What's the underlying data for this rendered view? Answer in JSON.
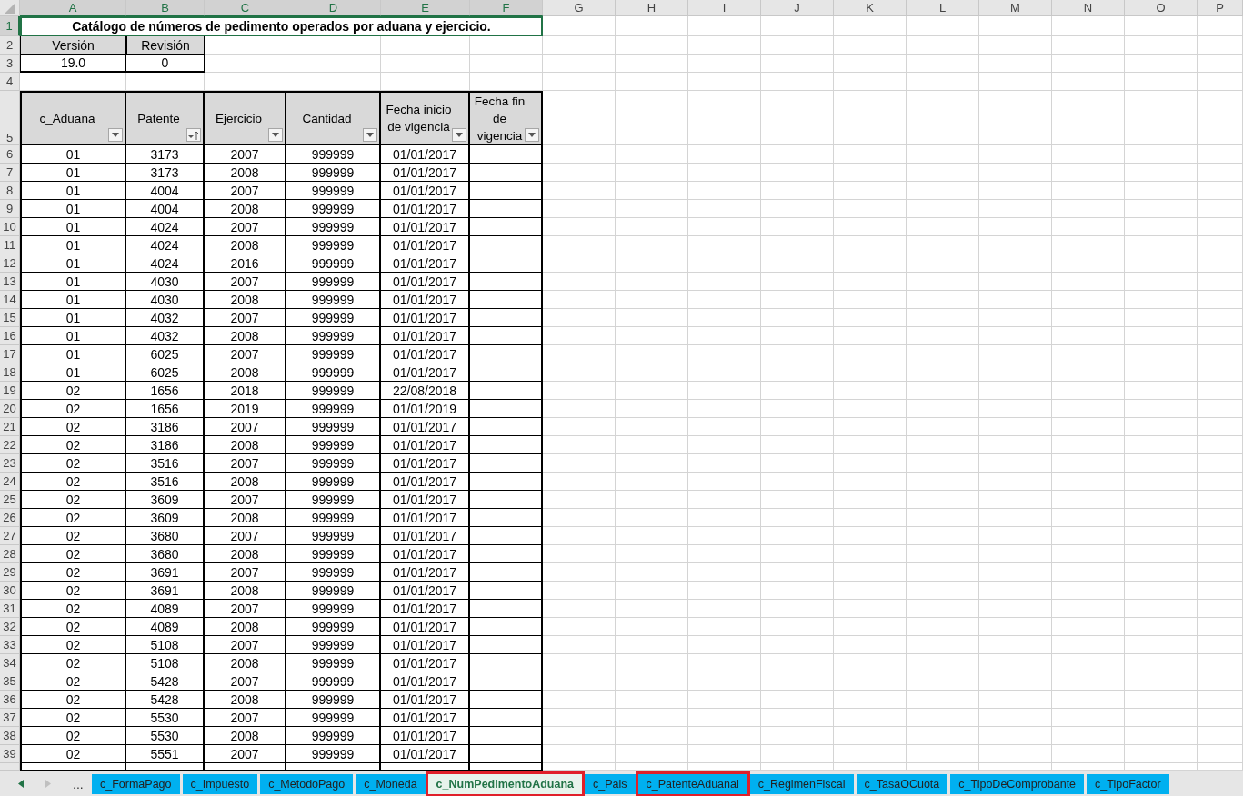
{
  "columns": [
    {
      "label": "A",
      "selected": true
    },
    {
      "label": "B",
      "selected": true
    },
    {
      "label": "C",
      "selected": true
    },
    {
      "label": "D",
      "selected": true
    },
    {
      "label": "E",
      "selected": true
    },
    {
      "label": "F",
      "selected": true
    },
    {
      "label": "G",
      "selected": false
    },
    {
      "label": "H",
      "selected": false
    },
    {
      "label": "I",
      "selected": false
    },
    {
      "label": "J",
      "selected": false
    },
    {
      "label": "K",
      "selected": false
    },
    {
      "label": "L",
      "selected": false
    },
    {
      "label": "M",
      "selected": false
    },
    {
      "label": "N",
      "selected": false
    },
    {
      "label": "O",
      "selected": false
    },
    {
      "label": "P",
      "selected": false
    }
  ],
  "rows": [
    {
      "kind": "title",
      "row": "1",
      "selected": true,
      "text": "Catálogo de números de pedimento operados por aduana y ejercicio."
    },
    {
      "kind": "info_header",
      "row": "2",
      "selected": false,
      "cells": [
        "Versión",
        "Revisión"
      ]
    },
    {
      "kind": "info_value",
      "row": "3",
      "selected": false,
      "cells": [
        "19.0",
        "0"
      ]
    },
    {
      "kind": "blank",
      "row": "4",
      "selected": false
    },
    {
      "kind": "table_header",
      "row": "5",
      "selected": false,
      "headers": [
        {
          "label": "c_Aduana",
          "kind": "filter"
        },
        {
          "label": "Patente",
          "kind": "sorted"
        },
        {
          "label": "Ejercicio",
          "kind": "filter"
        },
        {
          "label": "Cantidad",
          "kind": "filter"
        },
        {
          "label": "Fecha inicio de vigencia",
          "kind": "filter"
        },
        {
          "label": "Fecha fin de vigencia",
          "kind": "filter"
        }
      ]
    },
    {
      "kind": "data",
      "row": "6",
      "selected": false,
      "cells": [
        "01",
        "3173",
        "2007",
        "999999",
        "01/01/2017"
      ]
    },
    {
      "kind": "data",
      "row": "7",
      "selected": false,
      "cells": [
        "01",
        "3173",
        "2008",
        "999999",
        "01/01/2017"
      ]
    },
    {
      "kind": "data",
      "row": "8",
      "selected": false,
      "cells": [
        "01",
        "4004",
        "2007",
        "999999",
        "01/01/2017"
      ]
    },
    {
      "kind": "data",
      "row": "9",
      "selected": false,
      "cells": [
        "01",
        "4004",
        "2008",
        "999999",
        "01/01/2017"
      ]
    },
    {
      "kind": "data",
      "row": "10",
      "selected": false,
      "cells": [
        "01",
        "4024",
        "2007",
        "999999",
        "01/01/2017"
      ]
    },
    {
      "kind": "data",
      "row": "11",
      "selected": false,
      "cells": [
        "01",
        "4024",
        "2008",
        "999999",
        "01/01/2017"
      ]
    },
    {
      "kind": "data",
      "row": "12",
      "selected": false,
      "cells": [
        "01",
        "4024",
        "2016",
        "999999",
        "01/01/2017"
      ]
    },
    {
      "kind": "data",
      "row": "13",
      "selected": false,
      "cells": [
        "01",
        "4030",
        "2007",
        "999999",
        "01/01/2017"
      ]
    },
    {
      "kind": "data",
      "row": "14",
      "selected": false,
      "cells": [
        "01",
        "4030",
        "2008",
        "999999",
        "01/01/2017"
      ]
    },
    {
      "kind": "data",
      "row": "15",
      "selected": false,
      "cells": [
        "01",
        "4032",
        "2007",
        "999999",
        "01/01/2017"
      ]
    },
    {
      "kind": "data",
      "row": "16",
      "selected": false,
      "cells": [
        "01",
        "4032",
        "2008",
        "999999",
        "01/01/2017"
      ]
    },
    {
      "kind": "data",
      "row": "17",
      "selected": false,
      "cells": [
        "01",
        "6025",
        "2007",
        "999999",
        "01/01/2017"
      ]
    },
    {
      "kind": "data",
      "row": "18",
      "selected": false,
      "cells": [
        "01",
        "6025",
        "2008",
        "999999",
        "01/01/2017"
      ]
    },
    {
      "kind": "data",
      "row": "19",
      "selected": false,
      "cells": [
        "02",
        "1656",
        "2018",
        "999999",
        "22/08/2018"
      ]
    },
    {
      "kind": "data",
      "row": "20",
      "selected": false,
      "cells": [
        "02",
        "1656",
        "2019",
        "999999",
        "01/01/2019"
      ]
    },
    {
      "kind": "data",
      "row": "21",
      "selected": false,
      "cells": [
        "02",
        "3186",
        "2007",
        "999999",
        "01/01/2017"
      ]
    },
    {
      "kind": "data",
      "row": "22",
      "selected": false,
      "cells": [
        "02",
        "3186",
        "2008",
        "999999",
        "01/01/2017"
      ]
    },
    {
      "kind": "data",
      "row": "23",
      "selected": false,
      "cells": [
        "02",
        "3516",
        "2007",
        "999999",
        "01/01/2017"
      ]
    },
    {
      "kind": "data",
      "row": "24",
      "selected": false,
      "cells": [
        "02",
        "3516",
        "2008",
        "999999",
        "01/01/2017"
      ]
    },
    {
      "kind": "data",
      "row": "25",
      "selected": false,
      "cells": [
        "02",
        "3609",
        "2007",
        "999999",
        "01/01/2017"
      ]
    },
    {
      "kind": "data",
      "row": "26",
      "selected": false,
      "cells": [
        "02",
        "3609",
        "2008",
        "999999",
        "01/01/2017"
      ]
    },
    {
      "kind": "data",
      "row": "27",
      "selected": false,
      "cells": [
        "02",
        "3680",
        "2007",
        "999999",
        "01/01/2017"
      ]
    },
    {
      "kind": "data",
      "row": "28",
      "selected": false,
      "cells": [
        "02",
        "3680",
        "2008",
        "999999",
        "01/01/2017"
      ]
    },
    {
      "kind": "data",
      "row": "29",
      "selected": false,
      "cells": [
        "02",
        "3691",
        "2007",
        "999999",
        "01/01/2017"
      ]
    },
    {
      "kind": "data",
      "row": "30",
      "selected": false,
      "cells": [
        "02",
        "3691",
        "2008",
        "999999",
        "01/01/2017"
      ]
    },
    {
      "kind": "data",
      "row": "31",
      "selected": false,
      "cells": [
        "02",
        "4089",
        "2007",
        "999999",
        "01/01/2017"
      ]
    },
    {
      "kind": "data",
      "row": "32",
      "selected": false,
      "cells": [
        "02",
        "4089",
        "2008",
        "999999",
        "01/01/2017"
      ]
    },
    {
      "kind": "data",
      "row": "33",
      "selected": false,
      "cells": [
        "02",
        "5108",
        "2007",
        "999999",
        "01/01/2017"
      ]
    },
    {
      "kind": "data",
      "row": "34",
      "selected": false,
      "cells": [
        "02",
        "5108",
        "2008",
        "999999",
        "01/01/2017"
      ]
    },
    {
      "kind": "data",
      "row": "35",
      "selected": false,
      "cells": [
        "02",
        "5428",
        "2007",
        "999999",
        "01/01/2017"
      ]
    },
    {
      "kind": "data",
      "row": "36",
      "selected": false,
      "cells": [
        "02",
        "5428",
        "2008",
        "999999",
        "01/01/2017"
      ]
    },
    {
      "kind": "data",
      "row": "37",
      "selected": false,
      "cells": [
        "02",
        "5530",
        "2007",
        "999999",
        "01/01/2017"
      ]
    },
    {
      "kind": "data",
      "row": "38",
      "selected": false,
      "cells": [
        "02",
        "5530",
        "2008",
        "999999",
        "01/01/2017"
      ]
    },
    {
      "kind": "data",
      "row": "39",
      "selected": false,
      "cells": [
        "02",
        "5551",
        "2007",
        "999999",
        "01/01/2017"
      ]
    }
  ],
  "sheet_nav": {
    "more": "..."
  },
  "tabs": [
    {
      "label": "c_FormaPago",
      "selected": false,
      "flagged": false
    },
    {
      "label": "c_Impuesto",
      "selected": false,
      "flagged": false
    },
    {
      "label": "c_MetodoPago",
      "selected": false,
      "flagged": false
    },
    {
      "label": "c_Moneda",
      "selected": false,
      "flagged": false
    },
    {
      "label": "c_NumPedimentoAduana",
      "selected": true,
      "flagged": true
    },
    {
      "label": "c_Pais",
      "selected": false,
      "flagged": false
    },
    {
      "label": "c_PatenteAduanal",
      "selected": false,
      "flagged": true
    },
    {
      "label": "c_RegimenFiscal",
      "selected": false,
      "flagged": false
    },
    {
      "label": "c_TasaOCuota",
      "selected": false,
      "flagged": false
    },
    {
      "label": "c_TipoDeComprobante",
      "selected": false,
      "flagged": false
    },
    {
      "label": "c_TipoFactor",
      "selected": false,
      "flagged": false
    }
  ]
}
